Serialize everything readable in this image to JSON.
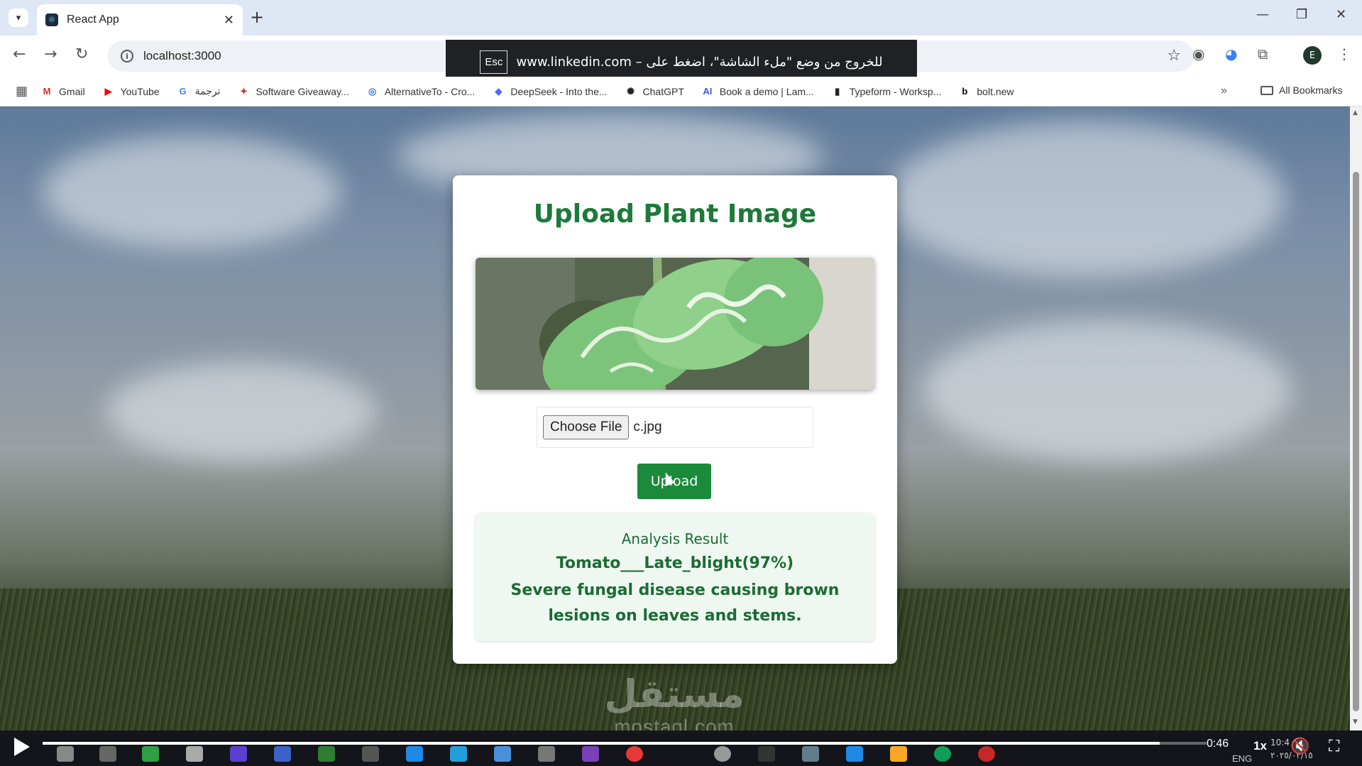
{
  "browser": {
    "tab_title": "React App",
    "url": "localhost:3000",
    "fullscreen_toast": {
      "key": "Esc",
      "message": "للخروج من وضع \"ملء الشاشة\"، اضغط على – www.linkedin.com"
    },
    "bookmarks": [
      {
        "label": "Gmail",
        "icon": "gmail-icon",
        "color": "#d93025",
        "glyph": "M"
      },
      {
        "label": "YouTube",
        "icon": "youtube-icon",
        "color": "#ff0000",
        "glyph": "▶"
      },
      {
        "label": "ترجمة",
        "icon": "translate-icon",
        "color": "#4285f4",
        "glyph": "G"
      },
      {
        "label": "Software Giveaway...",
        "icon": "gift-icon",
        "color": "#c0392b",
        "glyph": "✦"
      },
      {
        "label": "AlternativeTo - Cro...",
        "icon": "alternativeto-icon",
        "color": "#2b7de9",
        "glyph": "◎"
      },
      {
        "label": "DeepSeek - Into the...",
        "icon": "deepseek-icon",
        "color": "#4d6bfe",
        "glyph": "◆"
      },
      {
        "label": "ChatGPT",
        "icon": "chatgpt-icon",
        "color": "#222222",
        "glyph": "✺"
      },
      {
        "label": "Book a demo | Lam...",
        "icon": "ai-icon",
        "color": "#3b5bdb",
        "glyph": "AI"
      },
      {
        "label": "Typeform - Worksp...",
        "icon": "typeform-icon",
        "color": "#222222",
        "glyph": "▮"
      },
      {
        "label": "bolt.new",
        "icon": "bolt-icon",
        "color": "#000000",
        "glyph": "b"
      }
    ],
    "all_bookmarks_label": "All Bookmarks"
  },
  "app": {
    "title": "Upload Plant Image",
    "choose_file_label": "Choose File",
    "selected_file": "c.jpg",
    "upload_label": "Upload",
    "result": {
      "heading": "Analysis Result",
      "prediction": "Tomato___Late_blight(97%)",
      "description": "Severe fungal disease causing brown lesions on leaves and stems."
    },
    "colors": {
      "primary_green": "#1b8a3a",
      "title_green": "#1c7a3a",
      "result_bg": "#eef8f1"
    }
  },
  "overlay": {
    "watermark_ar": "مستقل",
    "watermark_latin": "mostaql.com",
    "time": "0:46",
    "speed": "1x",
    "lang": "ENG",
    "clock_time": "10:4",
    "clock_date": "٢٠٢٥/٠٣/١٥",
    "progress": 0.96
  }
}
